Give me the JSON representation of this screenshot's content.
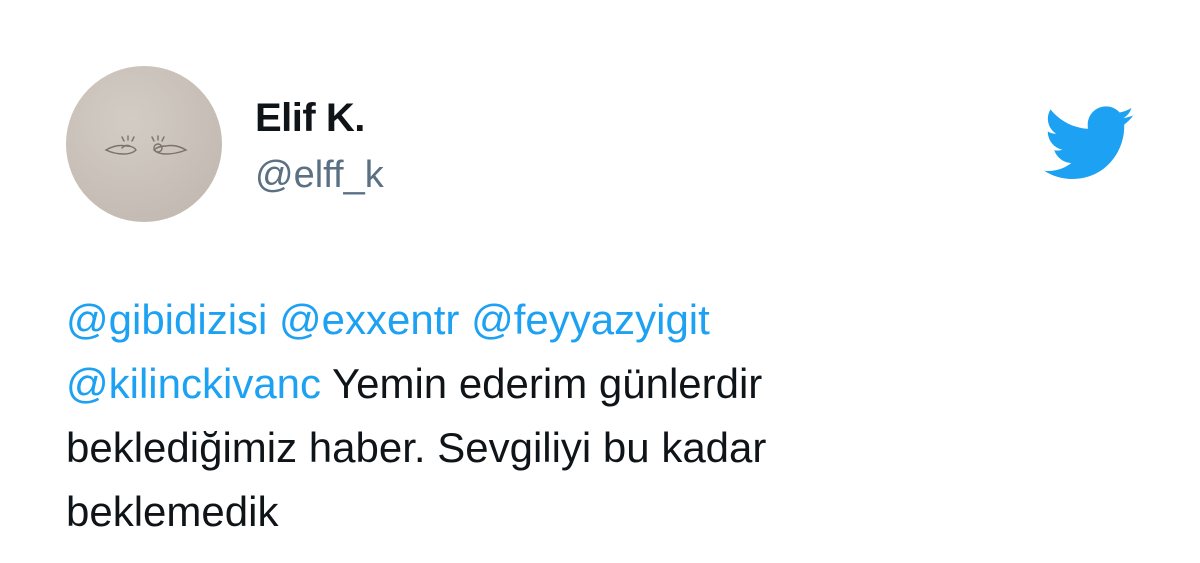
{
  "user": {
    "display_name": "Elif K.",
    "handle": "@elff_k",
    "avatar_icon": "hands-sketch-avatar"
  },
  "brand": {
    "logo_icon": "twitter-bird-icon",
    "accent_color": "#1da1f2"
  },
  "tweet": {
    "mentions": [
      "@gibidizisi",
      "@exxentr",
      "@feyyazyigit",
      "@kilinckivanc"
    ],
    "body_line1": " Yemin ederim günlerdir",
    "body_line2": "beklediğimiz haber. Sevgiliyi bu kadar",
    "body_line3": "beklemedik"
  }
}
